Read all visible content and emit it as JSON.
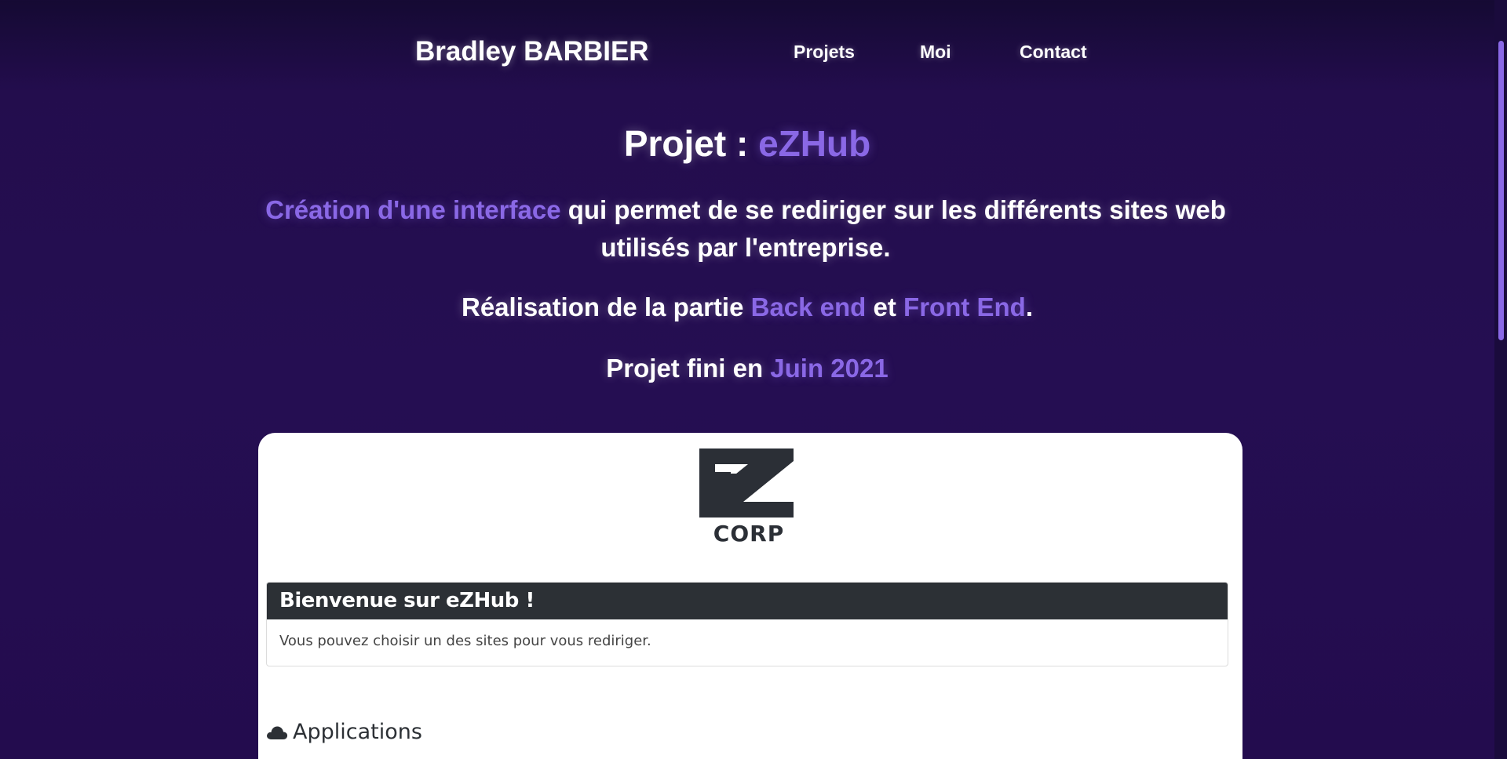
{
  "nav": {
    "brand": "Bradley BARBIER",
    "links": [
      "Projets",
      "Moi",
      "Contact"
    ]
  },
  "hero": {
    "title_prefix": "Projet : ",
    "title_accent": "eZHub",
    "desc_accent": "Création d'une interface",
    "desc_rest": " qui permet de se rediriger sur les différents sites web utilisés par l'entreprise.",
    "real_prefix": "Réalisation de la partie ",
    "real_accent1": "Back end",
    "real_mid": " et ",
    "real_accent2": "Front End",
    "real_suffix": ".",
    "date_prefix": "Projet fini en ",
    "date_accent": "Juin 2021"
  },
  "preview": {
    "logo_text": "CORP",
    "card_title": "Bienvenue sur eZHub !",
    "card_text": "Vous pouvez choisir un des sites pour vous rediriger.",
    "apps_heading": "Applications"
  },
  "colors": {
    "background": "#230d4d",
    "accent": "#8a68e6",
    "card_header": "#2c3035"
  }
}
